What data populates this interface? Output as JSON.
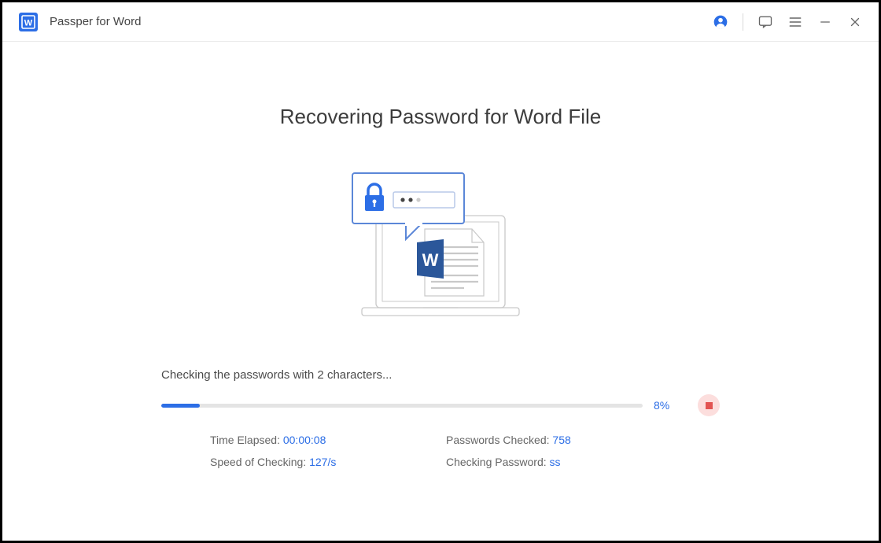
{
  "app": {
    "title": "Passper for Word"
  },
  "main": {
    "heading": "Recovering Password for Word File",
    "status_text": "Checking the passwords with 2 characters...",
    "progress_percent_text": "8%",
    "progress_percent_value": 8,
    "stats": {
      "time_elapsed_label": "Time Elapsed: ",
      "time_elapsed_value": "00:00:08",
      "speed_label": "Speed of Checking: ",
      "speed_value": "127/s",
      "passwords_checked_label": "Passwords Checked: ",
      "passwords_checked_value": "758",
      "checking_password_label": "Checking Password: ",
      "checking_password_value": "ss"
    }
  },
  "colors": {
    "accent": "#2c6ee6",
    "stop_bg": "#fcdedd",
    "stop_fg": "#e25452"
  }
}
